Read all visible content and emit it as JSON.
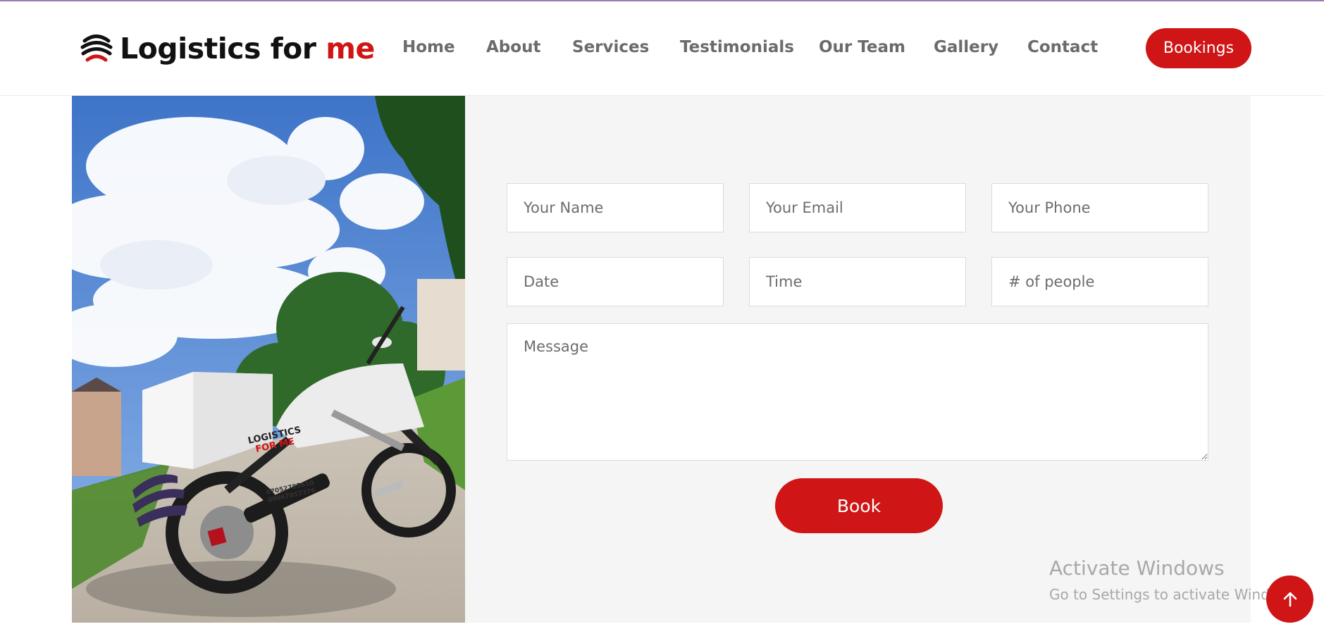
{
  "brand": {
    "name_main": "Logistics for ",
    "name_accent": "me",
    "accent_color": "#cf1515",
    "icon": "logo-swoosh-icon"
  },
  "nav": {
    "items": [
      {
        "label": "Home"
      },
      {
        "label": "About"
      },
      {
        "label": "Services"
      },
      {
        "label": "Testimonials"
      },
      {
        "label": "Our Team"
      },
      {
        "label": "Gallery"
      },
      {
        "label": "Contact"
      }
    ],
    "cta_label": "Bookings"
  },
  "booking_form": {
    "name_placeholder": "Your Name",
    "email_placeholder": "Your Email",
    "phone_placeholder": "Your Phone",
    "date_placeholder": "Date",
    "time_placeholder": "Time",
    "people_placeholder": "# of people",
    "message_placeholder": "Message",
    "submit_label": "Book"
  },
  "photo": {
    "box_text_line1": "LOGISTICS",
    "box_text_line2": "FOR ME",
    "box_phone1": "07052785610",
    "box_phone2": "09067857376"
  },
  "watermark": {
    "title": "Activate Windows",
    "subtitle": "Go to Settings to activate Windows."
  },
  "scroll_top": {
    "icon": "arrow-up-icon"
  }
}
